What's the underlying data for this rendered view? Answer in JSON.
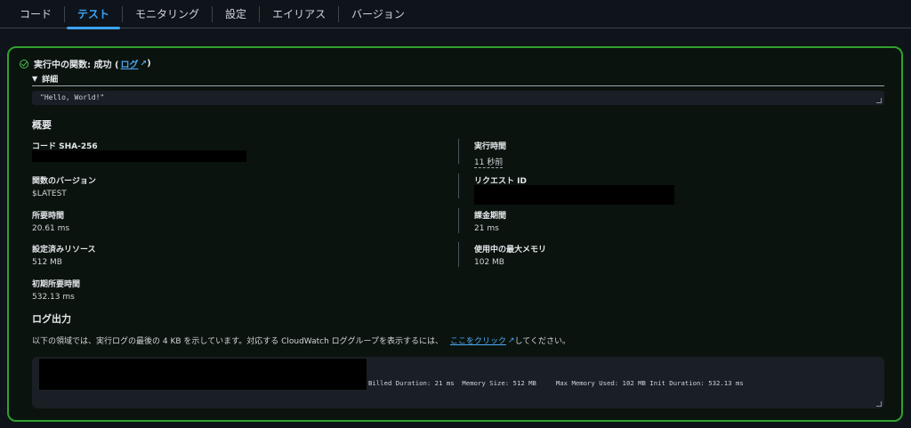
{
  "tabs": [
    "コード",
    "テスト",
    "モニタリング",
    "設定",
    "エイリアス",
    "バージョン"
  ],
  "status": {
    "text": "実行中の関数: 成功 (",
    "link": "ログ",
    "suffix": ")"
  },
  "details": {
    "toggle": "▼",
    "label": "詳細",
    "result": "\"Hello, World!\""
  },
  "summary": {
    "title": "概要",
    "code_sha_label": "コード SHA-256",
    "exec_time_label": "実行時間",
    "exec_time_value": "11 秒前",
    "version_label": "関数のバージョン",
    "version_value": "$LATEST",
    "request_id_label": "リクエスト ID",
    "duration_label": "所要時間",
    "duration_value": "20.61 ms",
    "billed_label": "課金期間",
    "billed_value": "21 ms",
    "resources_label": "設定済みリソース",
    "resources_value": "512 MB",
    "max_mem_label": "使用中の最大メモリ",
    "max_mem_value": "102 MB",
    "init_label": "初期所要時間",
    "init_value": "532.13 ms"
  },
  "log": {
    "title": "ログ出力",
    "desc": "以下の領域では、実行ログの最後の 4 KB を示しています。対応する CloudWatch ロググループを表示するには、",
    "link": "ここをクリック",
    "desc_suffix": "してください。",
    "output": "Billed Duration: 21 ms  Memory Size: 512 MB     Max Memory Used: 102 MB Init Duration: 532.13 ms"
  },
  "colors": {
    "accent": "#3ba3f5",
    "success": "#2fa12f",
    "link": "#4ea8f7"
  }
}
